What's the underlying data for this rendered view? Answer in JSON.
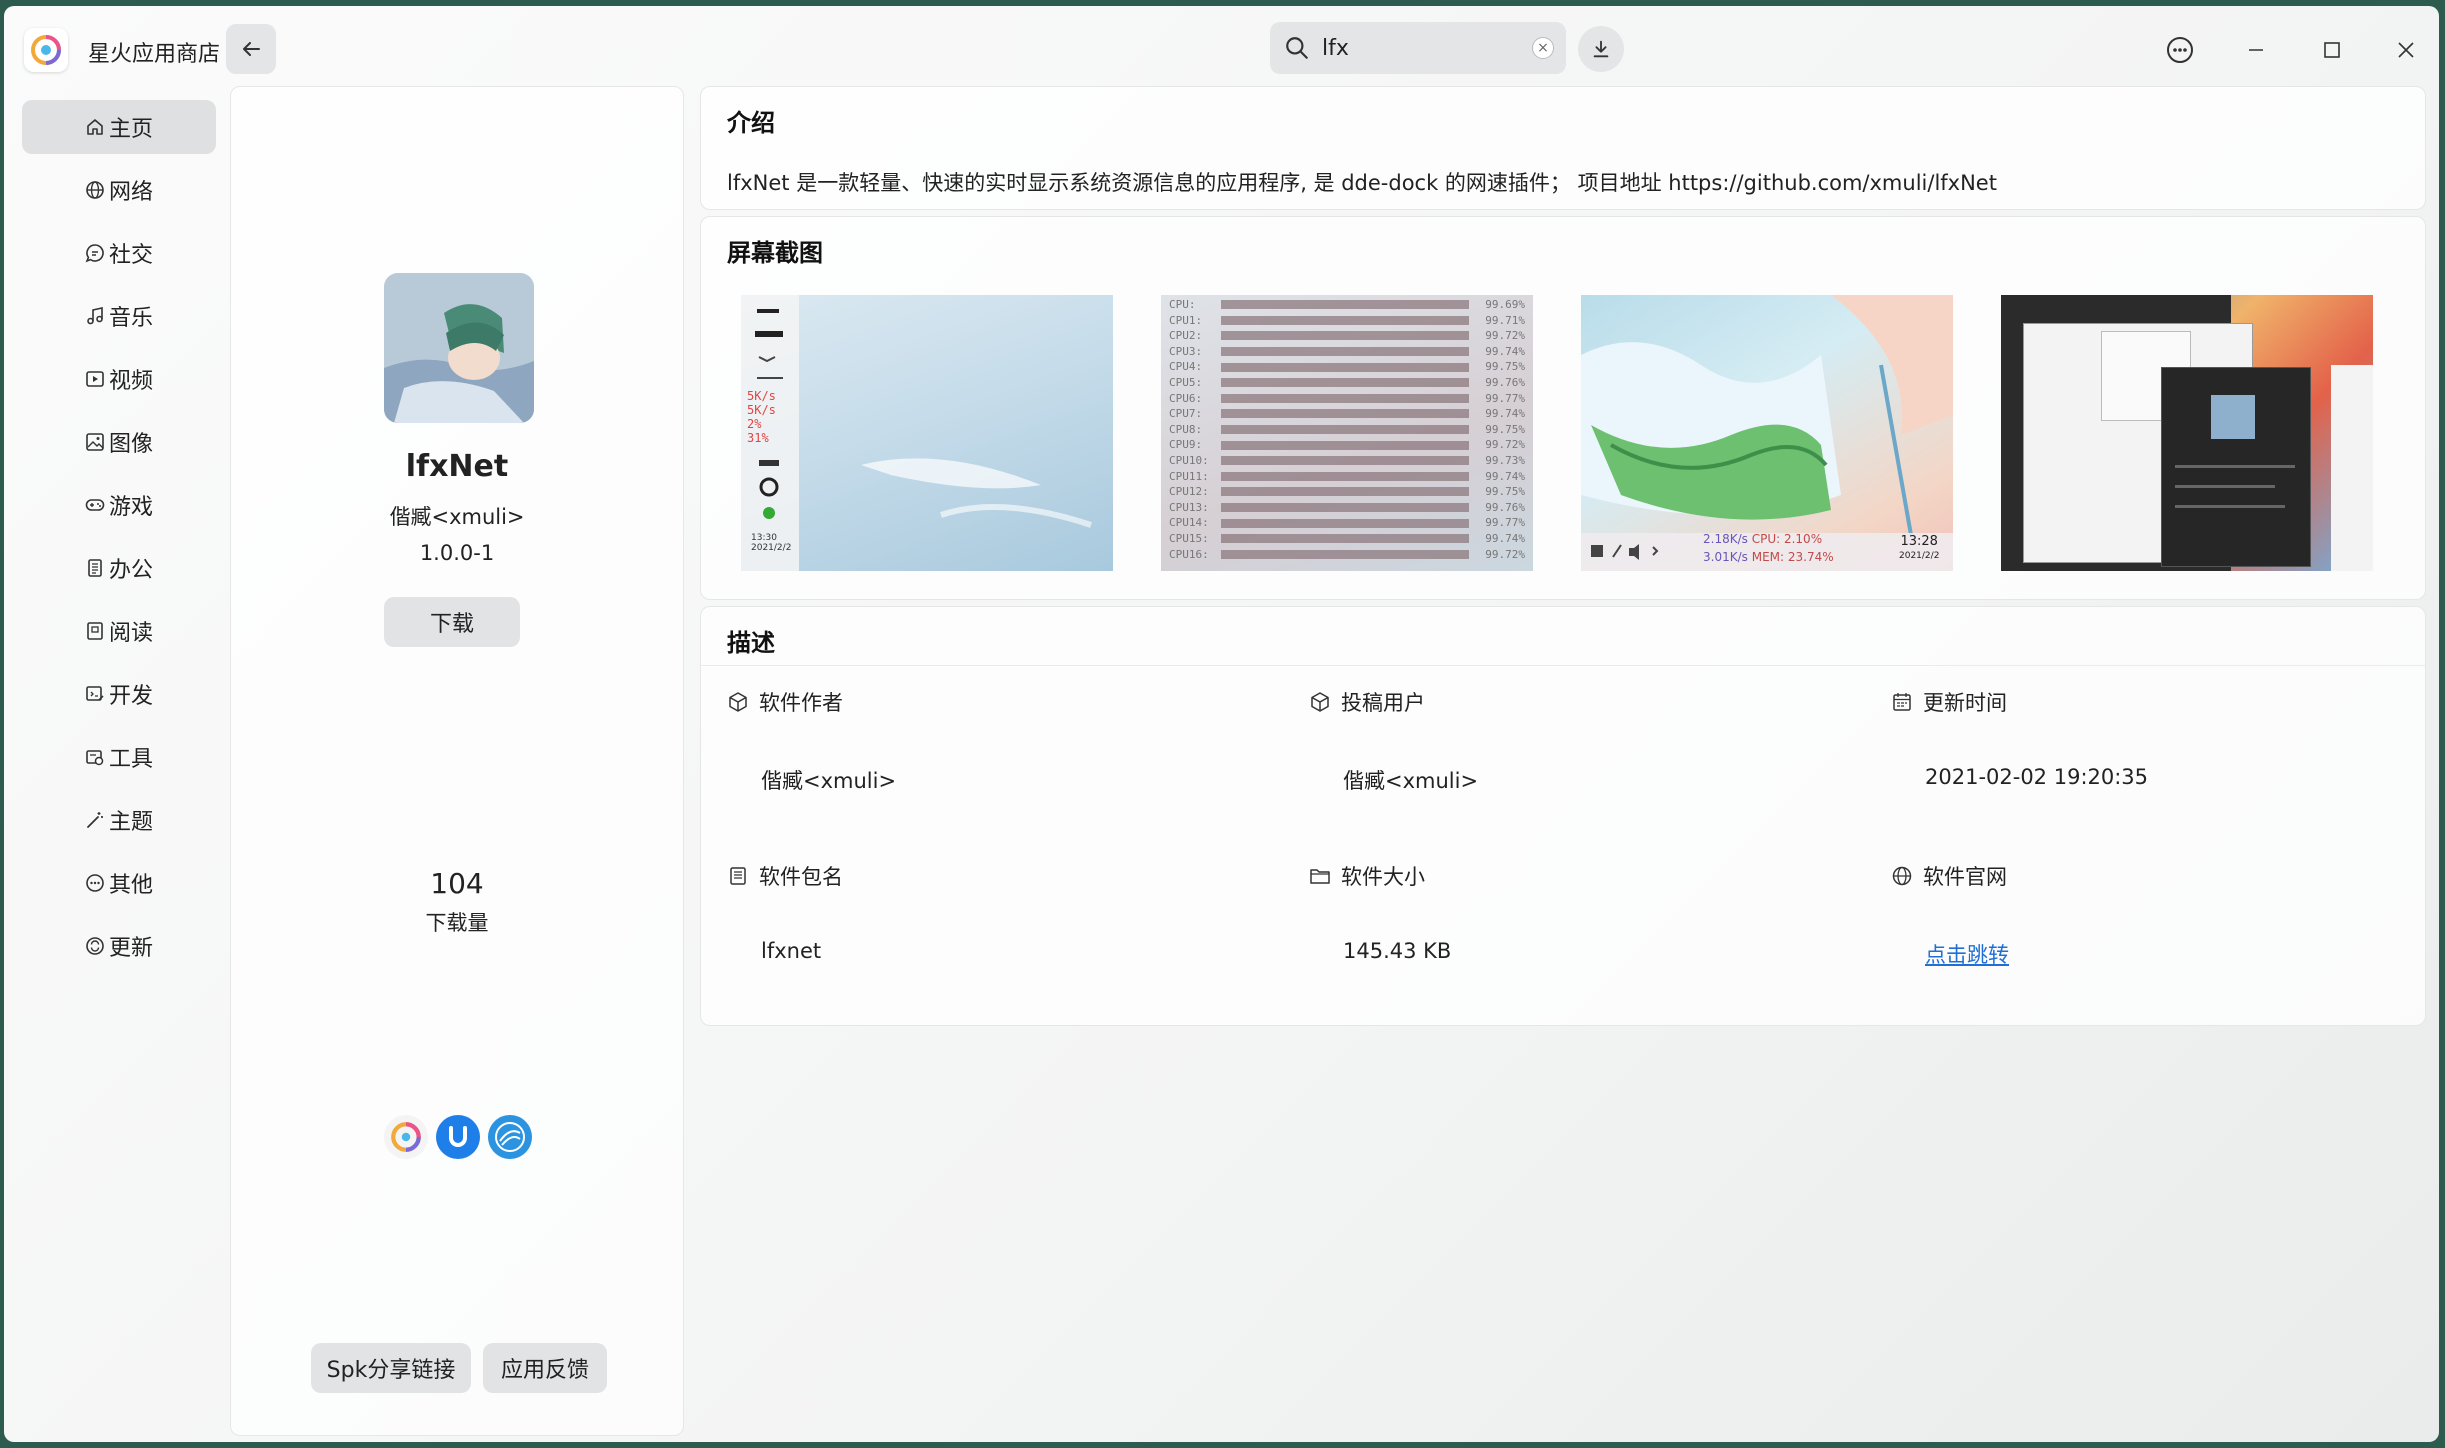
{
  "app": {
    "title": "星火应用商店"
  },
  "search": {
    "value": "lfx"
  },
  "sidebar": {
    "items": [
      {
        "label": "主页",
        "icon": "home-icon",
        "active": true
      },
      {
        "label": "网络",
        "icon": "globe-icon"
      },
      {
        "label": "社交",
        "icon": "chat-icon"
      },
      {
        "label": "音乐",
        "icon": "music-icon"
      },
      {
        "label": "视频",
        "icon": "video-icon"
      },
      {
        "label": "图像",
        "icon": "image-icon"
      },
      {
        "label": "游戏",
        "icon": "gamepad-icon"
      },
      {
        "label": "办公",
        "icon": "document-icon"
      },
      {
        "label": "阅读",
        "icon": "book-icon"
      },
      {
        "label": "开发",
        "icon": "code-icon"
      },
      {
        "label": "工具",
        "icon": "tools-icon"
      },
      {
        "label": "主题",
        "icon": "wand-icon"
      },
      {
        "label": "其他",
        "icon": "more-icon"
      },
      {
        "label": "更新",
        "icon": "update-icon"
      }
    ]
  },
  "detail": {
    "name": "lfxNet",
    "author": "偕臧<xmuli>",
    "version": "1.0.0-1",
    "download_label": "下载",
    "download_count": "104",
    "download_count_label": "下载量",
    "share_label": "Spk分享链接",
    "feedback_label": "应用反馈"
  },
  "intro": {
    "title": "介绍",
    "text": "lfxNet 是一款轻量、快速的实时显示系统资源信息的应用程序, 是 dde-dock 的网速插件； 项目地址 https://github.com/xmuli/lfxNet"
  },
  "screenshots": {
    "title": "屏幕截图",
    "shot1": {
      "rows": [
        "5K/s",
        "5K/s",
        "2%",
        "31%",
        "13:30",
        "2021/2/2"
      ]
    },
    "shot2": {
      "rows": [
        [
          "CPU:",
          "99.69%"
        ],
        [
          "CPU1:",
          "99.71%"
        ],
        [
          "CPU2:",
          "99.72%"
        ],
        [
          "CPU3:",
          "99.74%"
        ],
        [
          "CPU4:",
          "99.75%"
        ],
        [
          "CPU5:",
          "99.76%"
        ],
        [
          "CPU6:",
          "99.77%"
        ],
        [
          "CPU7:",
          "99.74%"
        ],
        [
          "CPU8:",
          "99.75%"
        ],
        [
          "CPU9:",
          "99.72%"
        ],
        [
          "CPU10:",
          "99.73%"
        ],
        [
          "CPU11:",
          "99.74%"
        ],
        [
          "CPU12:",
          "99.75%"
        ],
        [
          "CPU13:",
          "99.76%"
        ],
        [
          "CPU14:",
          "99.77%"
        ],
        [
          "CPU15:",
          "99.74%"
        ],
        [
          "CPU16:",
          "99.72%"
        ]
      ]
    },
    "shot3": {
      "net_up": "2.18K/s",
      "cpu": "CPU: 2.10%",
      "net_down": "3.01K/s",
      "mem": "MEM: 23.74%",
      "time": "13:28",
      "date": "2021/2/2"
    }
  },
  "description": {
    "title": "描述",
    "author_label": "软件作者",
    "author_value": "偕臧<xmuli>",
    "contributor_label": "投稿用户",
    "contributor_value": "偕臧<xmuli>",
    "updated_label": "更新时间",
    "updated_value": "2021-02-02 19:20:35",
    "package_label": "软件包名",
    "package_value": "lfxnet",
    "size_label": "软件大小",
    "size_value": "145.43 KB",
    "website_label": "软件官网",
    "website_value": "点击跳转"
  }
}
